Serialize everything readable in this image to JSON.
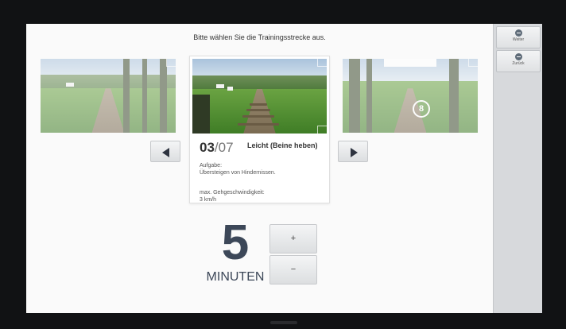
{
  "screen": {
    "title": "Bitte wählen Sie die Trainingsstrecke aus."
  },
  "sidebar": {
    "buttons": [
      {
        "label": "Weiter",
        "icon": "arrow-circle-icon"
      },
      {
        "label": "Zurück",
        "icon": "arrow-circle-icon"
      }
    ]
  },
  "carousel": {
    "current": "03",
    "total_sep": "/07",
    "level": "Leicht (Beine heben)",
    "task_label": "Aufgabe:",
    "task": "Übersteigen von Hindernissen.",
    "speed_label": "max. Gehgeschwindigkeit:",
    "speed": "3 km/h",
    "right_thumb_badge": "8",
    "prev_icon": "triangle-left-icon",
    "next_icon": "triangle-right-icon"
  },
  "duration": {
    "value": "5",
    "unit": "MINUTEN",
    "plus_label": "+",
    "minus_label": "−"
  },
  "colors": {
    "accent": "#3c4758",
    "sidebar": "#d7d9dc",
    "background": "#fafafa"
  }
}
